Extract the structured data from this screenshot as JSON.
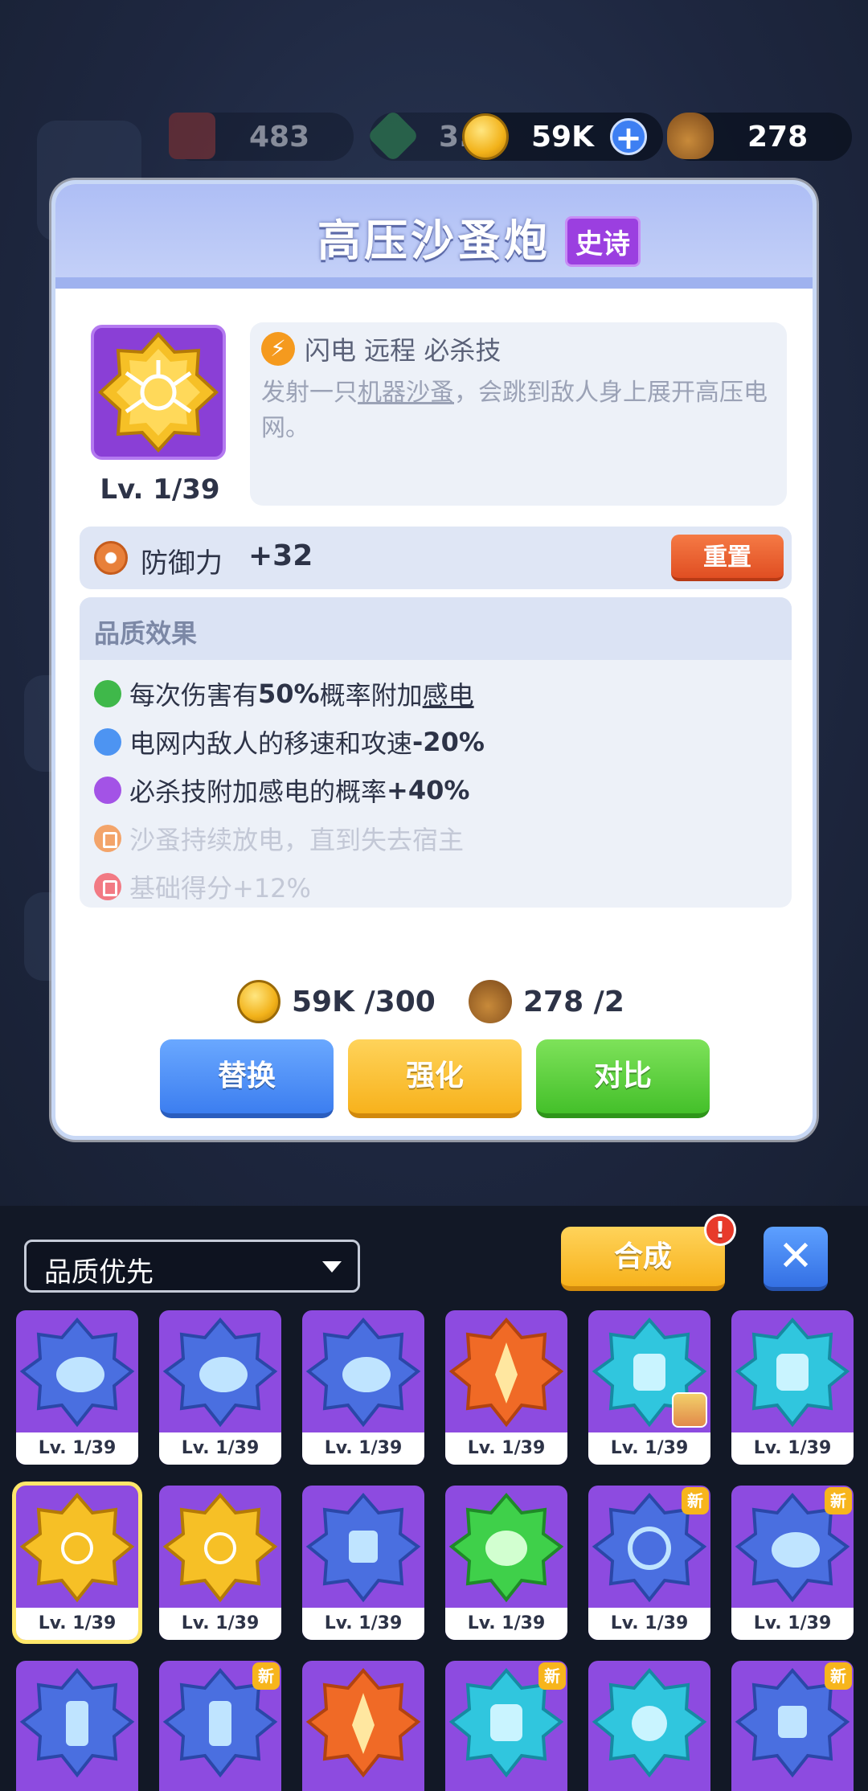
{
  "topbar": {
    "resources": [
      {
        "icon": "cake-icon",
        "value": "483"
      },
      {
        "icon": "gem-icon",
        "value": "3."
      },
      {
        "icon": "coin-icon",
        "value": "59K"
      },
      {
        "icon": "money-bag-icon",
        "value": "278"
      }
    ],
    "plus": "+"
  },
  "modal": {
    "title": "高压沙蚤炮",
    "rarity": "史诗",
    "level": "Lv. 1/39",
    "tags": "闪电 远程 必杀技",
    "desc_pre": "发射一只",
    "desc_link": "机器沙蚤",
    "desc_post": "，会跳到敌人身上展开高压电网。",
    "stat_label": "防御力",
    "stat_value": "+32",
    "reset_label": "重置",
    "quality_title": "品质效果",
    "effects": [
      {
        "pre": "每次伤害有",
        "bold": "50%",
        "mid": "概率附加",
        "link": "感电",
        "color": "#3fb84a",
        "locked": false
      },
      {
        "pre": "电网内敌人的移速和攻速",
        "bold": "-20%",
        "mid": "",
        "link": "",
        "color": "#4d94f2",
        "locked": false
      },
      {
        "pre": "必杀技附加感电的概率",
        "bold": "+40%",
        "mid": "",
        "link": "",
        "color": "#a353e6",
        "locked": false
      },
      {
        "pre": "沙蚤持续放电，直到失去宿主",
        "bold": "",
        "mid": "",
        "link": "",
        "color": "#f3a46a",
        "locked": true
      },
      {
        "pre": "基础得分+12%",
        "bold": "",
        "mid": "",
        "link": "",
        "color": "#f27a84",
        "locked": true
      }
    ],
    "cost_coin": "59K /300",
    "cost_bag": "278 /2",
    "btn_replace": "替换",
    "btn_upgrade": "强化",
    "btn_compare": "对比"
  },
  "bottom": {
    "sort_label": "品质优先",
    "craft_label": "合成",
    "alert": "!",
    "close": "✕",
    "card_level": "Lv. 1/39",
    "new_badge": "新"
  },
  "colors": {
    "accent_blue": "#3c7ef0",
    "accent_yellow": "#f7b21c",
    "accent_green": "#44c02a",
    "epic_purple": "#9b3fe0"
  }
}
